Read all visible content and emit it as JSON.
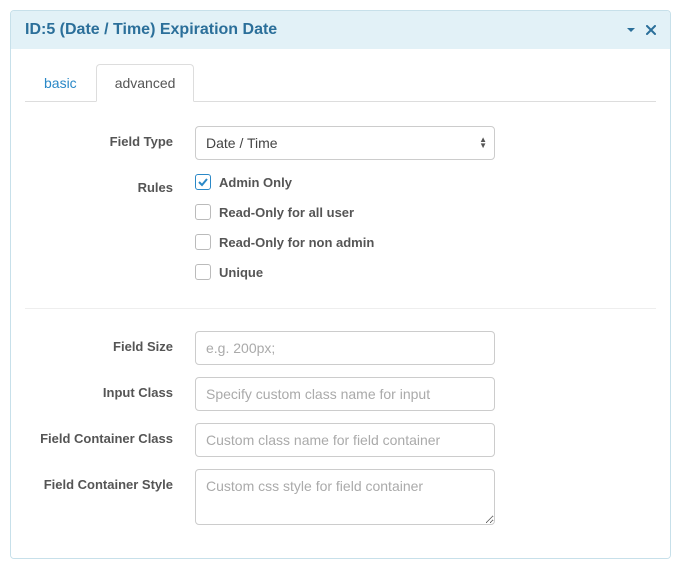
{
  "panel": {
    "title": "ID:5 (Date / Time) Expiration Date"
  },
  "tabs": {
    "basic": "basic",
    "advanced": "advanced"
  },
  "labels": {
    "fieldType": "Field Type",
    "rules": "Rules",
    "fieldSize": "Field Size",
    "inputClass": "Input Class",
    "fieldContainerClass": "Field Container Class",
    "fieldContainerStyle": "Field Container Style"
  },
  "fieldType": {
    "selected": "Date / Time"
  },
  "rules": {
    "adminOnly": {
      "label": "Admin Only",
      "checked": true
    },
    "readOnlyAll": {
      "label": "Read-Only for all user",
      "checked": false
    },
    "readOnlyNonAdmin": {
      "label": "Read-Only for non admin",
      "checked": false
    },
    "unique": {
      "label": "Unique",
      "checked": false
    }
  },
  "placeholders": {
    "fieldSize": "e.g. 200px;",
    "inputClass": "Specify custom class name for input",
    "fieldContainerClass": "Custom class name for field container",
    "fieldContainerStyle": "Custom css style for field container"
  },
  "values": {
    "fieldSize": "",
    "inputClass": "",
    "fieldContainerClass": "",
    "fieldContainerStyle": ""
  }
}
